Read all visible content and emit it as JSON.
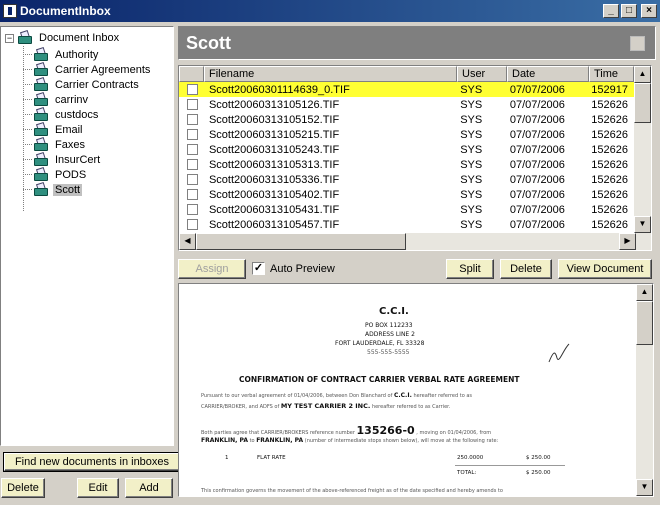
{
  "window": {
    "title": "DocumentInbox",
    "min": "_",
    "max": "□",
    "close": "×"
  },
  "tree": {
    "root": "Document Inbox",
    "items": [
      "Authority",
      "Carrier Agreements",
      "Carrier Contracts",
      "carrinv",
      "custdocs",
      "Email",
      "Faxes",
      "InsurCert",
      "PODS",
      "Scott"
    ],
    "selected": "Scott"
  },
  "left_buttons": {
    "find": "Find new documents in inboxes",
    "delete": "Delete",
    "edit": "Edit",
    "add": "Add"
  },
  "header": {
    "title": "Scott"
  },
  "file_list": {
    "columns": [
      "Filename",
      "User",
      "Date",
      "Time"
    ],
    "rows": [
      [
        "Scott20060301114639_0.TIF",
        "SYS",
        "07/07/2006",
        "152917"
      ],
      [
        "Scott20060313105126.TIF",
        "SYS",
        "07/07/2006",
        "152626"
      ],
      [
        "Scott20060313105152.TIF",
        "SYS",
        "07/07/2006",
        "152626"
      ],
      [
        "Scott20060313105215.TIF",
        "SYS",
        "07/07/2006",
        "152626"
      ],
      [
        "Scott20060313105243.TIF",
        "SYS",
        "07/07/2006",
        "152626"
      ],
      [
        "Scott20060313105313.TIF",
        "SYS",
        "07/07/2006",
        "152626"
      ],
      [
        "Scott20060313105336.TIF",
        "SYS",
        "07/07/2006",
        "152626"
      ],
      [
        "Scott20060313105402.TIF",
        "SYS",
        "07/07/2006",
        "152626"
      ],
      [
        "Scott20060313105431.TIF",
        "SYS",
        "07/07/2006",
        "152626"
      ],
      [
        "Scott20060313105457.TIF",
        "SYS",
        "07/07/2006",
        "152626"
      ]
    ],
    "highlighted_row": 0
  },
  "toolbar": {
    "assign": "Assign",
    "auto_preview": "Auto Preview",
    "auto_preview_checked": "✓",
    "split": "Split",
    "delete": "Delete",
    "view_document": "View Document"
  },
  "preview_doc": {
    "company": "C.C.I.",
    "address1": "PO BOX 112233",
    "address2": "ADDRESS LINE 2",
    "city": "FORT LAUDERDALE, FL  33328",
    "phone": "555-555-5555",
    "heading": "CONFIRMATION OF CONTRACT CARRIER VERBAL RATE AGREEMENT",
    "para1a": "Pursuant to our verbal agreement of 01/04/2006, between Don Blanchard of",
    "para1b": "C.C.I.",
    "para1c": "hereafter referred to as",
    "para1d": "CARRIER/BROKER, and ADFS of",
    "para1e": "MY TEST CARRIER 2 INC.",
    "para1f": "hereafter referred to as Carrier.",
    "para2a": "Both parties agree that CARRIER/BROKERS reference number",
    "ref": "135266-0",
    "para2b": ", moving  on 01/04/2006, from",
    "para2c": "FRANKLIN, PA",
    "para2d": "to",
    "para2e": "FRANKLIN, PA",
    "para2f": "(number of intermediate stops shown below), will move at the following rate:",
    "line_no": "1",
    "line_desc": "FLAT RATE",
    "line_rate": "250.0000",
    "line_amt": "$ 250.00",
    "total_label": "TOTAL:",
    "total_amt": "$ 250.00",
    "para3": "This confirmation governs the movement of the above-referenced freight as of the date specified and hereby amends to"
  }
}
